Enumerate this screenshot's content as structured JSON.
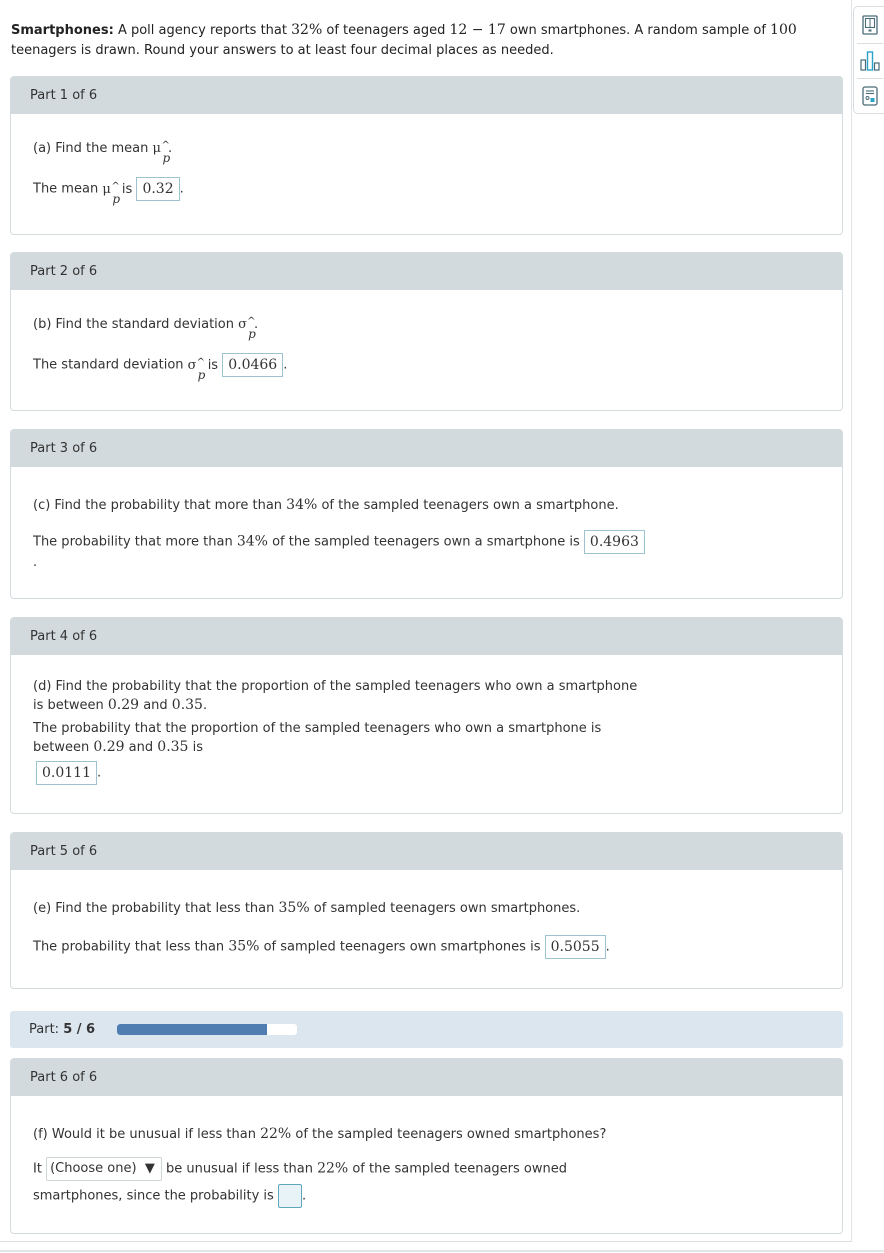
{
  "intro": {
    "title": "Smartphones:",
    "text_before_pct": "A poll agency reports that",
    "pct": "32%",
    "text_after_pct": "of teenagers aged",
    "age_range": "12 − 17",
    "text_after_age": "own smartphones. A random sample of",
    "sample_size": "100",
    "text_end": "teenagers is drawn. Round your answers to at least four decimal places as needed."
  },
  "tools": [
    {
      "name": "textbook-icon"
    },
    {
      "name": "chart-icon"
    },
    {
      "name": "calculator-icon"
    }
  ],
  "parts": [
    {
      "header": "Part 1 of 6",
      "question": "(a) Find the mean",
      "answer_prefix": "The mean",
      "answer_mid": "is",
      "symbol": "μ",
      "answer": "0.32"
    },
    {
      "header": "Part 2 of 6",
      "question": "(b) Find the standard deviation",
      "answer_prefix": "The standard deviation",
      "answer_mid": "is",
      "symbol": "σ",
      "answer": "0.0466"
    },
    {
      "header": "Part 3 of 6",
      "question_a": "(c) Find the probability that more than",
      "question_pct": "34%",
      "question_b": "of the sampled teenagers own a smartphone.",
      "answer_a": "The probability that more than",
      "answer_pct": "34%",
      "answer_b": "of the sampled teenagers own a smartphone is",
      "answer": "0.4963"
    },
    {
      "header": "Part 4 of 6",
      "question_line1": "(d) Find the probability that the proportion of the sampled teenagers who own a smartphone",
      "question_line2_a": "is between",
      "low": "0.29",
      "and": "and",
      "high": "0.35",
      "answer_line1": "The probability that the proportion of the sampled teenagers who own a smartphone is",
      "answer_line2_a": "between",
      "answer_line2_b": "is",
      "answer": "0.0111"
    },
    {
      "header": "Part 5 of 6",
      "question_a": "(e) Find the probability that less than",
      "question_pct": "35%",
      "question_b": "of sampled teenagers own smartphones.",
      "answer_a": "The probability that less than",
      "answer_pct": "35%",
      "answer_b": "of sampled teenagers own smartphones is",
      "answer": "0.5055"
    },
    {
      "header": "Part 6 of 6",
      "question_a": "(f) Would it be unusual if less than",
      "question_pct": "22%",
      "question_b": "of the sampled teenagers owned smartphones?",
      "answer_it": "It",
      "select_value": "(Choose one)",
      "select_arrow": "▼",
      "answer_a": "be unusual if less than",
      "answer_pct": "22%",
      "answer_b": "of the sampled teenagers owned",
      "answer_line2": "smartphones, since the probability is",
      "answer": ""
    }
  ],
  "progress": {
    "label": "Part:",
    "current": "5 / 6",
    "fraction": 0.833
  },
  "hat": "^",
  "phat_sub": "p",
  "period": "."
}
